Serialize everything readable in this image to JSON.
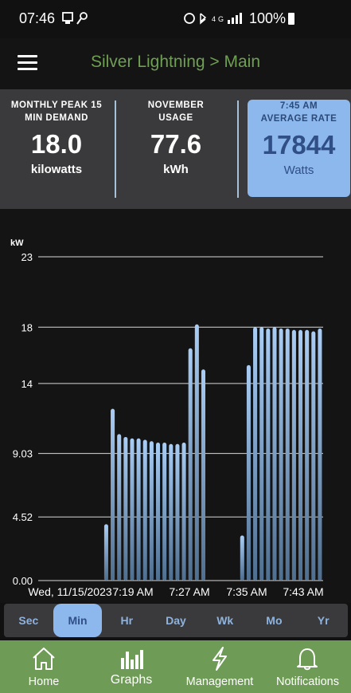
{
  "status_bar": {
    "time": "07:46",
    "battery": "100%",
    "left_icons": [
      "media-icon",
      "wrench-icon"
    ],
    "right_icons": [
      "alarm-icon",
      "bluetooth-icon",
      "signal-icon"
    ]
  },
  "header": {
    "title": "Silver Lightning > Main",
    "title_color": "#6f9f53"
  },
  "metrics": [
    {
      "label_line1": "MONTHLY PEAK 15",
      "label_line2": "MIN DEMAND",
      "value": "18.0",
      "unit": "kilowatts"
    },
    {
      "label_line1": "NOVEMBER",
      "label_line2": "USAGE",
      "value": "77.6",
      "unit": "kWh"
    },
    {
      "label_line1": "7:45 AM",
      "label_line2": "AVERAGE RATE",
      "value": "17844",
      "unit": "Watts",
      "highlight_color": "#8db8ee"
    }
  ],
  "chart_data": {
    "type": "bar",
    "ylabel": "kW",
    "ytick_labels": [
      "0.00",
      "4.52",
      "9.03",
      "14",
      "18",
      "23"
    ],
    "ytick_values": [
      0,
      4.52,
      9.03,
      14,
      18,
      23
    ],
    "ylim": [
      0,
      23
    ],
    "xtick_labels": [
      "Wed, 11/15/2023",
      "7:19 AM",
      "7:27 AM",
      "7:35 AM",
      "7:43 AM"
    ],
    "grid": true,
    "bar_color": "#8db8ee",
    "values": [
      null,
      null,
      null,
      null,
      null,
      null,
      null,
      null,
      null,
      null,
      4.0,
      12.2,
      10.4,
      10.2,
      10.1,
      10.1,
      10.0,
      9.9,
      9.8,
      9.8,
      9.7,
      9.7,
      9.8,
      16.5,
      18.2,
      15.0,
      null,
      null,
      null,
      null,
      null,
      3.2,
      15.3,
      18.0,
      18.0,
      17.9,
      18.0,
      17.9,
      17.9,
      17.8,
      17.8,
      17.8,
      17.7,
      17.9
    ]
  },
  "time_tabs": {
    "items": [
      "Sec",
      "Min",
      "Hr",
      "Day",
      "Wk",
      "Mo",
      "Yr"
    ],
    "active": "Min"
  },
  "bottom_nav": {
    "items": [
      {
        "label": "Home",
        "icon": "home-icon"
      },
      {
        "label": "Graphs",
        "icon": "bar-chart-icon"
      },
      {
        "label": "Management",
        "icon": "lightning-icon"
      },
      {
        "label": "Notifications",
        "icon": "bell-icon"
      }
    ],
    "active": "Graphs",
    "bg_color": "#6e9b55"
  }
}
